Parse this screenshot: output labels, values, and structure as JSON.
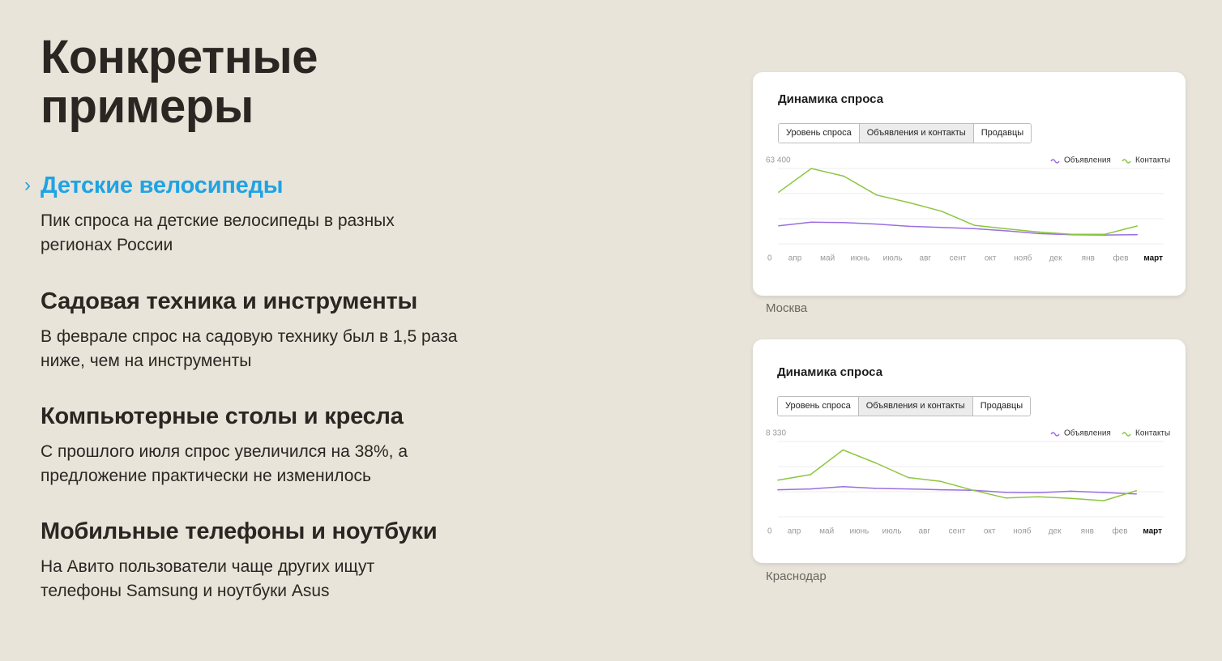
{
  "title": "Конкретные примеры",
  "topics": [
    {
      "heading": "Детские велосипеды",
      "text": "Пик спроса на детские велосипеды в разных регионах России"
    },
    {
      "heading": "Садовая техника и инструменты",
      "text": "В феврале спрос на садовую технику был в 1,5 раза ниже, чем на инструменты"
    },
    {
      "heading": "Компьютерные столы и кресла",
      "text": "С прошлого июля спрос увеличился на 38%, а предложение практически не изменилось"
    },
    {
      "heading": "Мобильные телефоны и ноутбуки",
      "text": "На Авито пользователи чаще других ищут телефоны Samsung и ноутбуки Asus"
    }
  ],
  "active_topic_chevron": "›",
  "colors": {
    "background": "#e8e4da",
    "accent": "#1fa3e4",
    "listings": "#9b6ee0",
    "contacts": "#8cc63f"
  },
  "cards": [
    {
      "title": "Динамика спроса",
      "tabs": [
        "Уровень спроса",
        "Объявления и контакты",
        "Продавцы"
      ],
      "selected_tab": "Объявления и контакты",
      "city": "Москва"
    },
    {
      "title": "Динамика спроса",
      "tabs": [
        "Уровень спроса",
        "Объявления и контакты",
        "Продавцы"
      ],
      "selected_tab": "Объявления и контакты",
      "city": "Краснодар"
    }
  ],
  "chart_data": [
    {
      "type": "line",
      "x": [
        "мар",
        "апр",
        "май",
        "июнь",
        "июль",
        "авг",
        "сент",
        "окт",
        "нояб",
        "дек",
        "янв",
        "фев"
      ],
      "x_tick_labels": [
        "апр",
        "май",
        "июнь",
        "июль",
        "авг",
        "сент",
        "окт",
        "нояб",
        "дек",
        "янв",
        "фев",
        "март"
      ],
      "highlighted_tick": "март",
      "y_tick_labels": [
        "0",
        "63 400"
      ],
      "ylim": [
        0,
        63400
      ],
      "grid": true,
      "legend_position": "top-right",
      "series": [
        {
          "name": "Объявления",
          "color": "#9b6ee0",
          "values": [
            15200,
            18200,
            17900,
            16600,
            14700,
            13800,
            12800,
            10900,
            8600,
            7700,
            7400,
            7700
          ]
        },
        {
          "name": "Контакты",
          "color": "#8cc63f",
          "values": [
            43500,
            63400,
            56900,
            41100,
            34700,
            27400,
            15600,
            12600,
            9900,
            8000,
            8000,
            15000
          ]
        }
      ]
    },
    {
      "type": "line",
      "x": [
        "мар",
        "апр",
        "май",
        "июнь",
        "июль",
        "авг",
        "сент",
        "окт",
        "нояб",
        "дек",
        "янв",
        "фев"
      ],
      "x_tick_labels": [
        "апр",
        "май",
        "июнь",
        "июль",
        "авг",
        "сент",
        "окт",
        "нояб",
        "дек",
        "янв",
        "фев",
        "март"
      ],
      "highlighted_tick": "март",
      "y_tick_labels": [
        "0",
        "8 330"
      ],
      "ylim": [
        0,
        8330
      ],
      "grid": true,
      "legend_position": "top-right",
      "series": [
        {
          "name": "Объявления",
          "color": "#9b6ee0",
          "values": [
            2990,
            3080,
            3340,
            3140,
            3080,
            2990,
            2940,
            2700,
            2660,
            2830,
            2690,
            2530
          ]
        },
        {
          "name": "Контакты",
          "color": "#8cc63f",
          "values": [
            4060,
            4670,
            7400,
            5960,
            4340,
            3910,
            2930,
            2080,
            2220,
            2040,
            1780,
            2880
          ]
        }
      ]
    }
  ]
}
